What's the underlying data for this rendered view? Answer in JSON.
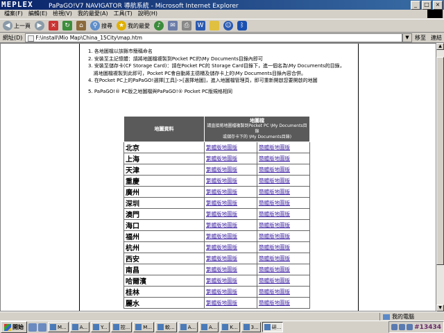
{
  "window": {
    "title": "PaPaGO!V7 NAVIGATOR 導航系統 - Microsoft Internet Explorer",
    "logo": "MEPLEX",
    "buttons": [
      "_",
      "□",
      "×"
    ]
  },
  "menu": [
    "檔案(F)",
    "編輯(E)",
    "檢視(V)",
    "我的最愛(A)",
    "工具(T)",
    "說明(H)"
  ],
  "toolbar": {
    "back_label": "上一頁",
    "search_label": "搜尋",
    "favorites_label": "我的最愛"
  },
  "address": {
    "label": "網址(D)",
    "value": "F:\\install\\Mio Map\\China_15City\\map.htm",
    "go_label": "移至",
    "links_label": "連結"
  },
  "instructions": [
    "1. 各地圖檔以該縣市簡稱命名",
    "2. 安裝至主記憶體：請將地圖檔複製到Pocket PC的\\My Documents目錄內即可",
    "3. 安裝至儲存卡(CF Storage Card)：請在Pocket PC的 Storage Card目錄下，進一個名為\\My Documents的目錄，",
    "將地圖檔複製到此即可，Pocket PC會自動將主德櫃及儲存卡上的\\My Documents目錄內容合併。",
    "4. 在Pocket PC上的PaPaGO!選擇[工具]->[選擇地圖]，進入地圖檔管理頁，即可重新開啟您要開啟的地圖",
    "5. PaPaGO!® PC版之地圖檔與PaPaGO!® Pocket PC版規格相同"
  ],
  "table": {
    "col1_header": "地圖資料",
    "col2_header": "地圖檔",
    "col2_subheader_1": "請直接將地圖檔複製到Pocket PC \\My Documents目錄",
    "col2_subheader_2": "或儲存卡下的 \\My Documents目錄)",
    "trad_label": "繁體版地圖版",
    "simp_label": "簡體版地圖版",
    "cities": [
      "北京",
      "上海",
      "天津",
      "重慶",
      "廣州",
      "深圳",
      "澳門",
      "海口",
      "福州",
      "杭州",
      "西安",
      "南昌",
      "哈爾濱",
      "桂林",
      "麗水"
    ]
  },
  "status": {
    "zone": "我的電腦"
  },
  "taskbar": {
    "start": "開始",
    "tasks": [
      "M...",
      "A...",
      "Y...",
      "控...",
      "M...",
      "軟...",
      "A...",
      "A...",
      "K...",
      "3...",
      "研..."
    ],
    "active_index": 10,
    "clock": "#13434"
  }
}
